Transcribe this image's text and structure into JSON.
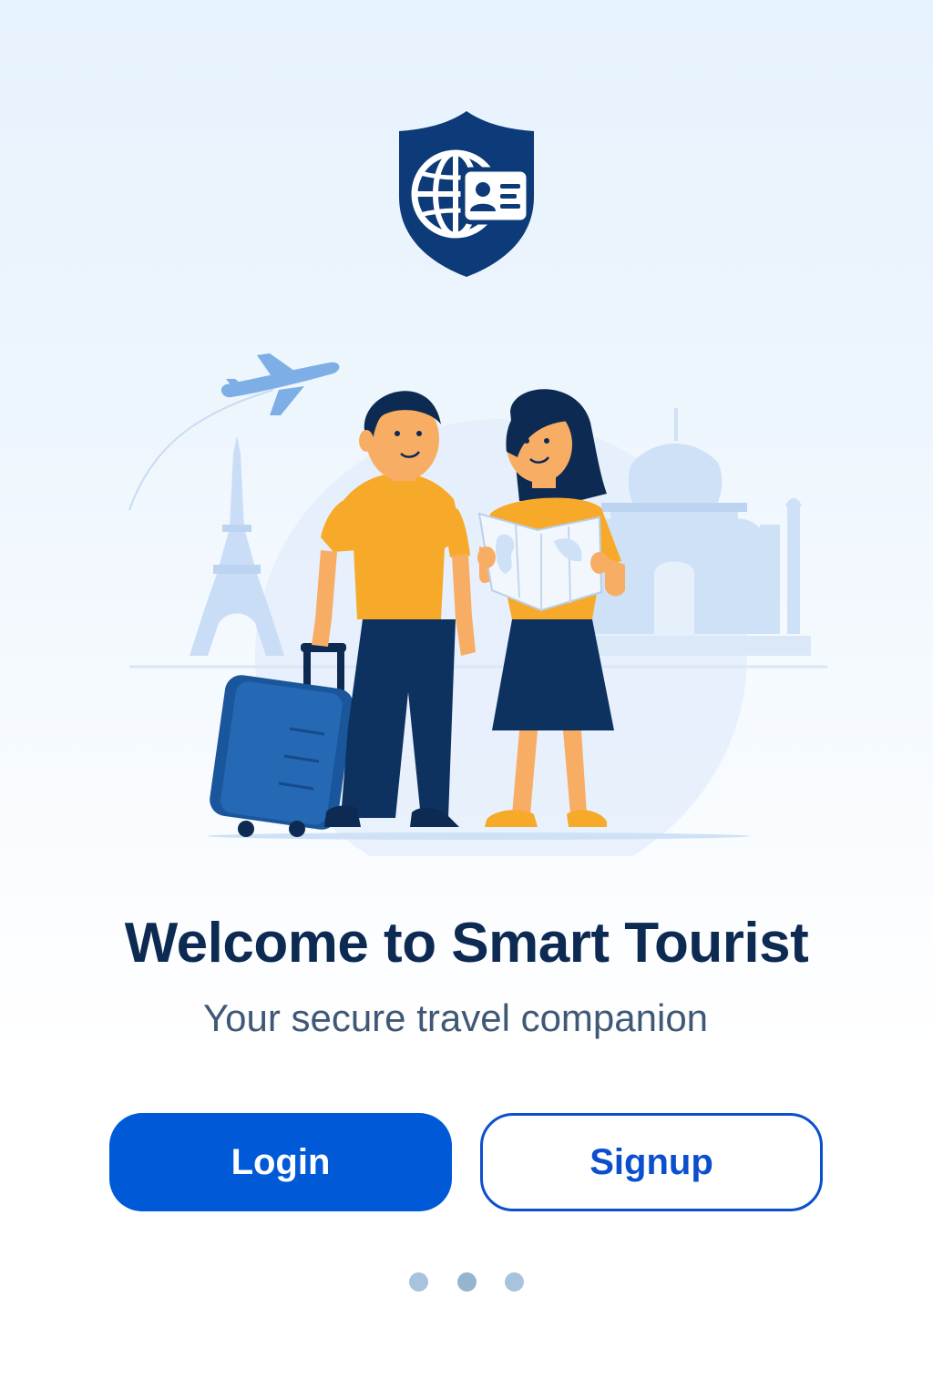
{
  "app": {
    "logo_icon": "shield-globe-id-icon"
  },
  "hero": {
    "illustration": "tourist-couple-with-luggage-and-map",
    "landmarks": [
      "eiffel-tower-icon",
      "taj-mahal-icon",
      "airplane-icon"
    ]
  },
  "welcome": {
    "title": "Welcome to Smart Tourist",
    "subtitle": "Your secure travel companion"
  },
  "actions": {
    "login_label": "Login",
    "signup_label": "Signup"
  },
  "pagination": {
    "total": 3,
    "current": 2
  },
  "colors": {
    "brand_dark": "#0d2a52",
    "primary": "#005ad8",
    "accent": "#f8a92b",
    "subtitle": "#3f5875"
  }
}
